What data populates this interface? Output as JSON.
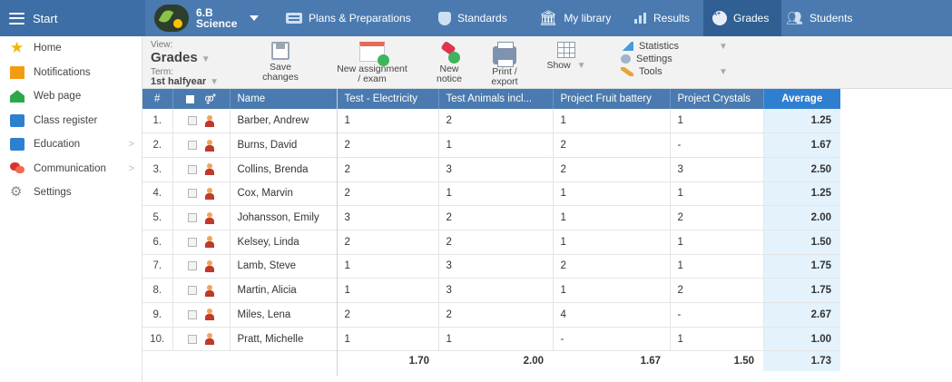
{
  "topbar": {
    "start_label": "Start",
    "class_line1": "6.B",
    "class_line2": "Science",
    "nav": [
      {
        "label": "Plans & Preparations",
        "icon": "plans-icon"
      },
      {
        "label": "Standards",
        "icon": "shield-icon"
      },
      {
        "label": "My library",
        "icon": "library-icon"
      },
      {
        "label": "Results",
        "icon": "bar-chart-icon"
      },
      {
        "label": "Grades",
        "icon": "grades-icon",
        "active": true
      },
      {
        "label": "Students",
        "icon": "students-icon"
      }
    ]
  },
  "sidebar": {
    "items": [
      {
        "label": "Home",
        "icon": "star-icon"
      },
      {
        "label": "Notifications",
        "icon": "envelope-icon"
      },
      {
        "label": "Web page",
        "icon": "house-icon"
      },
      {
        "label": "Class register",
        "icon": "register-icon"
      },
      {
        "label": "Education",
        "icon": "education-icon",
        "has_submenu": true
      },
      {
        "label": "Communication",
        "icon": "chat-icon",
        "has_submenu": true
      },
      {
        "label": "Settings",
        "icon": "gear-icon"
      }
    ]
  },
  "toolbar": {
    "view_label": "View:",
    "view_value": "Grades",
    "term_label": "Term:",
    "term_value": "1st halfyear",
    "save_line1": "Save",
    "save_line2": "changes",
    "assign_line1": "New assignment",
    "assign_line2": "/ exam",
    "notice_line1": "New",
    "notice_line2": "notice",
    "print_line1": "Print /",
    "print_line2": "export",
    "show_label": "Show",
    "menu_statistics": "Statistics",
    "menu_settings": "Settings",
    "menu_tools": "Tools"
  },
  "grid": {
    "headers": {
      "number": "#",
      "name": "Name",
      "col1": "Test - Electricity",
      "col2": "Test Animals incl...",
      "col3": "Project Fruit battery",
      "col4": "Project Crystals",
      "average": "Average"
    },
    "rows": [
      {
        "n": "1.",
        "name": "Barber, Andrew",
        "g1": "1",
        "g2": "2",
        "g3": "1",
        "g4": "1",
        "avg": "1.25"
      },
      {
        "n": "2.",
        "name": "Burns, David",
        "g1": "2",
        "g2": "1",
        "g3": "2",
        "g4": "-",
        "avg": "1.67"
      },
      {
        "n": "3.",
        "name": "Collins, Brenda",
        "g1": "2",
        "g2": "3",
        "g3": "2",
        "g4": "3",
        "avg": "2.50"
      },
      {
        "n": "4.",
        "name": "Cox, Marvin",
        "g1": "2",
        "g2": "1",
        "g3": "1",
        "g4": "1",
        "avg": "1.25"
      },
      {
        "n": "5.",
        "name": "Johansson, Emily",
        "g1": "3",
        "g2": "2",
        "g3": "1",
        "g4": "2",
        "avg": "2.00"
      },
      {
        "n": "6.",
        "name": "Kelsey, Linda",
        "g1": "2",
        "g2": "2",
        "g3": "1",
        "g4": "1",
        "avg": "1.50"
      },
      {
        "n": "7.",
        "name": "Lamb, Steve",
        "g1": "1",
        "g2": "3",
        "g3": "2",
        "g4": "1",
        "avg": "1.75"
      },
      {
        "n": "8.",
        "name": "Martin, Alicia",
        "g1": "1",
        "g2": "3",
        "g3": "1",
        "g4": "2",
        "avg": "1.75"
      },
      {
        "n": "9.",
        "name": "Miles, Lena",
        "g1": "2",
        "g2": "2",
        "g3": "4",
        "g4": "-",
        "avg": "2.67"
      },
      {
        "n": "10.",
        "name": "Pratt, Michelle",
        "g1": "1",
        "g2": "1",
        "g3": "-",
        "g4": "1",
        "avg": "1.00"
      }
    ],
    "footer": {
      "col1": "1.70",
      "col2": "2.00",
      "col3": "1.67",
      "col4": "1.50",
      "average": "1.73"
    }
  },
  "colors": {
    "topbar": "#4a7ab0",
    "active_tab": "#2f5f93",
    "average_header": "#2f7fd1",
    "average_cell": "#e4f2fb"
  }
}
